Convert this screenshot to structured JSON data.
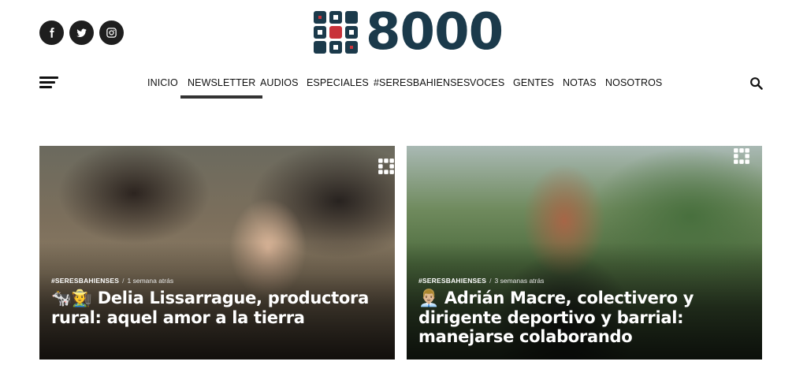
{
  "header": {
    "logo_text": "8000",
    "logo_icon": "crossed-pattern-logo",
    "social": [
      {
        "name": "facebook",
        "icon": "facebook-icon"
      },
      {
        "name": "twitter",
        "icon": "twitter-icon"
      },
      {
        "name": "instagram",
        "icon": "instagram-icon"
      }
    ]
  },
  "nav": {
    "items": [
      "INICIO",
      "NEWSLETTER",
      "AUDIOS",
      "ESPECIALES",
      "#SERESBAHIENSES",
      "VOCES",
      "GENTES",
      "NOTAS",
      "NOSOTROS"
    ],
    "active": "NEWSLETTER"
  },
  "cards": [
    {
      "category": "#SERESBAHIENSES",
      "time": "1 semana atrás",
      "title": "🐄🧑‍🌾 Delia Lissarrague, productora rural: aquel amor a la tierra"
    },
    {
      "category": "#SERESBAHIENSES",
      "time": "3 semanas atrás",
      "title": "👨🏼‍💼 Adrián Macre, colectivero y dirigente deportivo y barrial: manejarse colaborando"
    }
  ],
  "colors": {
    "brand_navy": "#1b3a4b",
    "brand_red": "#c8323a",
    "nav_underline": "#333333"
  }
}
